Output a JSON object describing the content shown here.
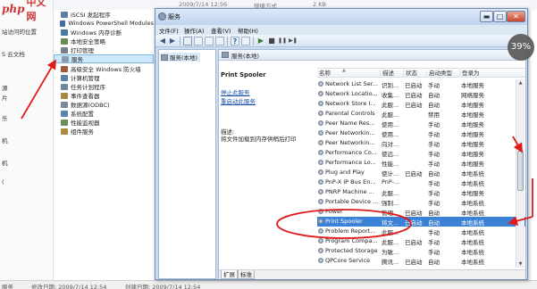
{
  "logo": {
    "brand": "php",
    "cn": "中文网"
  },
  "bg_left_items": [
    "站访问的位置",
    "S 云文档",
    "源",
    "片",
    "乐",
    "机",
    "机",
    "("
  ],
  "bg_top": {
    "date": "2009/7/14 12:56",
    "type": "快捷方式",
    "size": "2 KB"
  },
  "bg_tree": [
    {
      "label": "iSCSI 发起程序",
      "color": "#5e7ea8"
    },
    {
      "label": "Windows PowerShell Modules",
      "color": "#3f6ca8"
    },
    {
      "label": "Windows 内存诊断",
      "color": "#4a7aa4"
    },
    {
      "label": "本地安全策略",
      "color": "#6b8b55"
    },
    {
      "label": "打印管理",
      "color": "#777e8c"
    },
    {
      "label": "服务",
      "color": "#8c9bae"
    },
    {
      "label": "高级安全 Windows 防火墙",
      "color": "#a05a3c"
    },
    {
      "label": "计算机管理",
      "color": "#5a7fa8"
    },
    {
      "label": "任务计划程序",
      "color": "#6a88a0"
    },
    {
      "label": "事件查看器",
      "color": "#a88a45"
    },
    {
      "label": "数据源(ODBC)",
      "color": "#7a8899"
    },
    {
      "label": "系统配置",
      "color": "#5b84b0"
    },
    {
      "label": "性能监视器",
      "color": "#6c8c5c"
    },
    {
      "label": "组件服务",
      "color": "#aa8c3c"
    }
  ],
  "bg_status": {
    "name": "服务",
    "modified": "修改日期: 2009/7/14 12:54",
    "created": "创建日期: 2009/7/14 12:54"
  },
  "window": {
    "title": "服务",
    "min": "▬",
    "max": "□",
    "close": "✕"
  },
  "menu": [
    "文件(F)",
    "操作(A)",
    "查看(V)",
    "帮助(H)"
  ],
  "toolbar": {
    "back": "◀",
    "forward": "▶",
    "play": "▶",
    "stop": "■",
    "pause": "❚❚",
    "restart": "▶❚"
  },
  "tree_root": "服务(本地)",
  "main_header": "服务(本地)",
  "detail": {
    "name": "Print Spooler",
    "stop_link": "停止此服务",
    "restart_link": "重启动此服务",
    "desc_label": "描述:",
    "desc": "将文件加载到内存供稍后打印"
  },
  "columns": [
    "名称",
    "描述",
    "状态",
    "启动类型",
    "登录为"
  ],
  "services": [
    {
      "name": "Network List Ser...",
      "desc": "识别...",
      "status": "已启动",
      "startup": "手动",
      "logon": "本地服务"
    },
    {
      "name": "Network Locatio...",
      "desc": "收集...",
      "status": "已启动",
      "startup": "自动",
      "logon": "网络服务"
    },
    {
      "name": "Network Store I...",
      "desc": "此服...",
      "status": "已启动",
      "startup": "自动",
      "logon": "本地服务"
    },
    {
      "name": "Parental Controls",
      "desc": "此服...",
      "status": "",
      "startup": "禁用",
      "logon": "本地服务"
    },
    {
      "name": "Peer Name Res...",
      "desc": "使用...",
      "status": "",
      "startup": "手动",
      "logon": "本地服务"
    },
    {
      "name": "Peer Networkin...",
      "desc": "使用...",
      "status": "",
      "startup": "手动",
      "logon": "本地服务"
    },
    {
      "name": "Peer Networkin...",
      "desc": "向对...",
      "status": "",
      "startup": "手动",
      "logon": "本地服务"
    },
    {
      "name": "Performance Co...",
      "desc": "使远...",
      "status": "",
      "startup": "手动",
      "logon": "本地服务"
    },
    {
      "name": "Performance Lo...",
      "desc": "性能...",
      "status": "",
      "startup": "手动",
      "logon": "本地服务"
    },
    {
      "name": "Plug and Play",
      "desc": "使计...",
      "status": "已启动",
      "startup": "自动",
      "logon": "本地系统"
    },
    {
      "name": "PnP-X IP Bus En...",
      "desc": "PnP-...",
      "status": "",
      "startup": "手动",
      "logon": "本地系统"
    },
    {
      "name": "PNRP Machine ...",
      "desc": "此服...",
      "status": "",
      "startup": "手动",
      "logon": "本地服务"
    },
    {
      "name": "Portable Device ...",
      "desc": "强制...",
      "status": "",
      "startup": "手动",
      "logon": "本地系统"
    },
    {
      "name": "Power",
      "desc": "管理...",
      "status": "已启动",
      "startup": "自动",
      "logon": "本地系统"
    },
    {
      "name": "Print Spooler",
      "desc": "将文...",
      "status": "已启动",
      "startup": "自动",
      "logon": "本地系统"
    },
    {
      "name": "Problem Report...",
      "desc": "此服...",
      "status": "",
      "startup": "手动",
      "logon": "本地系统"
    },
    {
      "name": "Program Compa...",
      "desc": "此服...",
      "status": "已启动",
      "startup": "手动",
      "logon": "本地系统"
    },
    {
      "name": "Protected Storage",
      "desc": "为敏...",
      "status": "",
      "startup": "手动",
      "logon": "本地系统"
    },
    {
      "name": "QPCore Service",
      "desc": "腾讯...",
      "status": "已启动",
      "startup": "自动",
      "logon": "本地系统"
    }
  ],
  "selected_service": "Print Spooler",
  "tabs": [
    "扩展",
    "标准"
  ],
  "progress_badge": "39%",
  "colors": {
    "selection": "#3b82d6",
    "annotation": "#e01b1b",
    "link": "#1a4fa8"
  }
}
